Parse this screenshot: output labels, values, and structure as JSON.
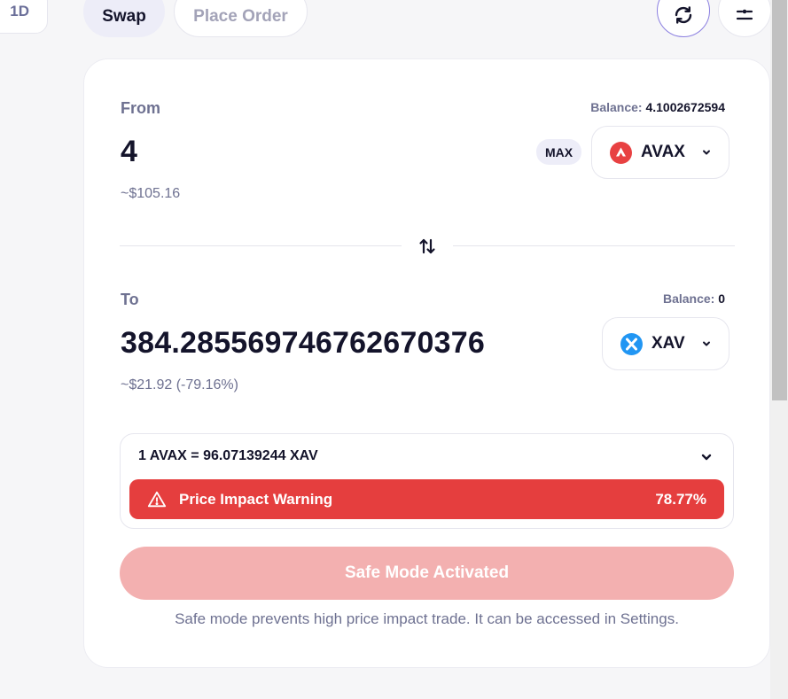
{
  "topbar": {
    "timeframe": "1D",
    "tab_swap": "Swap",
    "tab_place_order": "Place Order"
  },
  "from": {
    "label": "From",
    "balance_label": "Balance:",
    "balance_value": "4.1002672594",
    "amount": "4",
    "usd": "~$105.16",
    "max_label": "MAX",
    "token": "AVAX"
  },
  "to": {
    "label": "To",
    "balance_label": "Balance:",
    "balance_value": "0",
    "amount": "384.285569746762670376",
    "usd": "~$21.92 (-79.16%)",
    "token": "XAV"
  },
  "rate": {
    "text": "1 AVAX = 96.07139244 XAV"
  },
  "warning": {
    "label": "Price Impact Warning",
    "value": "78.77%"
  },
  "action": {
    "button_label": "Safe Mode Activated",
    "note": "Safe mode prevents high price impact trade. It can be accessed in Settings."
  },
  "colors": {
    "accent": "#8b7fe0",
    "danger": "#e53e3e",
    "avax": "#e84142",
    "xav": "#2196f3"
  }
}
